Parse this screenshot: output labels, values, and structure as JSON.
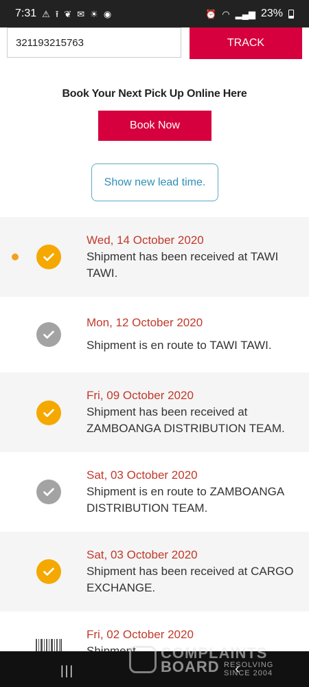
{
  "status_bar": {
    "time": "7:31",
    "left_icons": [
      "warning-icon",
      "upload-icon",
      "leaf-icon",
      "mail-icon",
      "weather-icon",
      "messenger-icon"
    ],
    "right_icons": [
      "alarm-icon",
      "wifi-icon",
      "signal-icon"
    ],
    "battery": "23%"
  },
  "tracking": {
    "number": "321193215763",
    "button_label": "TRACK"
  },
  "booking": {
    "heading": "Book Your Next Pick Up Online Here",
    "button_label": "Book Now",
    "lead_time_label": "Show new lead time."
  },
  "timeline": [
    {
      "date": "Wed, 14 October 2020",
      "desc": "Shipment has been received at TAWI TAWI.",
      "status": "done",
      "current": true
    },
    {
      "date": "Mon, 12 October 2020",
      "desc": "Shipment is en route to TAWI TAWI.",
      "status": "route",
      "current": false
    },
    {
      "date": "Fri, 09 October 2020",
      "desc": "Shipment has been received at ZAMBOANGA DISTRIBUTION TEAM.",
      "status": "done",
      "current": false
    },
    {
      "date": "Sat, 03 October 2020",
      "desc": "Shipment is en route to ZAMBOANGA DISTRIBUTION TEAM.",
      "status": "route",
      "current": false
    },
    {
      "date": "Sat, 03 October 2020",
      "desc": "Shipment has been received at CARGO EXCHANGE.",
      "status": "done",
      "current": false
    },
    {
      "date": "Fri, 02 October 2020",
      "desc": "Shipment",
      "status": "barcode",
      "current": false
    }
  ],
  "colors": {
    "brand_red": "#d5003d",
    "done_yellow": "#f5a800",
    "route_grey": "#a3a3a3",
    "date_red": "#c0392b",
    "link_blue": "#2e8fb5"
  },
  "nav_bar": {
    "icons": [
      "recents-icon",
      "back-icon"
    ]
  },
  "watermark": {
    "line1": "COMPLAINTS",
    "line2": "BOARD",
    "line3": "RESOLVING SINCE 2004"
  }
}
